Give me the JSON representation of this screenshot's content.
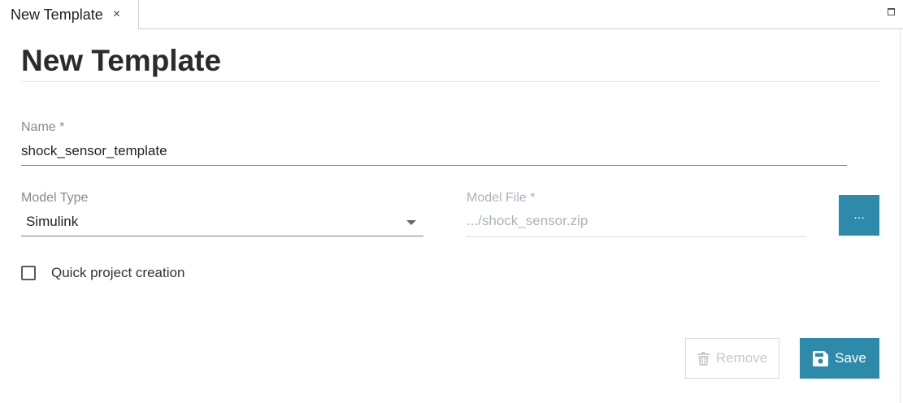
{
  "tab": {
    "label": "New Template",
    "close_glyph": "×"
  },
  "page": {
    "title": "New Template"
  },
  "form": {
    "name": {
      "label": "Name *",
      "value": "shock_sensor_template"
    },
    "model_type": {
      "label": "Model Type",
      "value": "Simulink"
    },
    "model_file": {
      "label": "Model File *",
      "value": ".../shock_sensor.zip",
      "browse_label": "..."
    },
    "quick_project": {
      "label": "Quick project creation",
      "checked": false
    }
  },
  "actions": {
    "remove_label": "Remove",
    "save_label": "Save"
  },
  "icons": {
    "close": "close-icon",
    "maximize": "maximize-icon",
    "dropdown": "chevron-down-icon",
    "remove": "trash-icon",
    "save": "floppy-disk-icon"
  },
  "colors": {
    "accent": "#2e8aab",
    "disabled_text": "#c8c8c8",
    "muted_label": "#8a8a8a",
    "readonly_text": "#a9b4bf"
  }
}
